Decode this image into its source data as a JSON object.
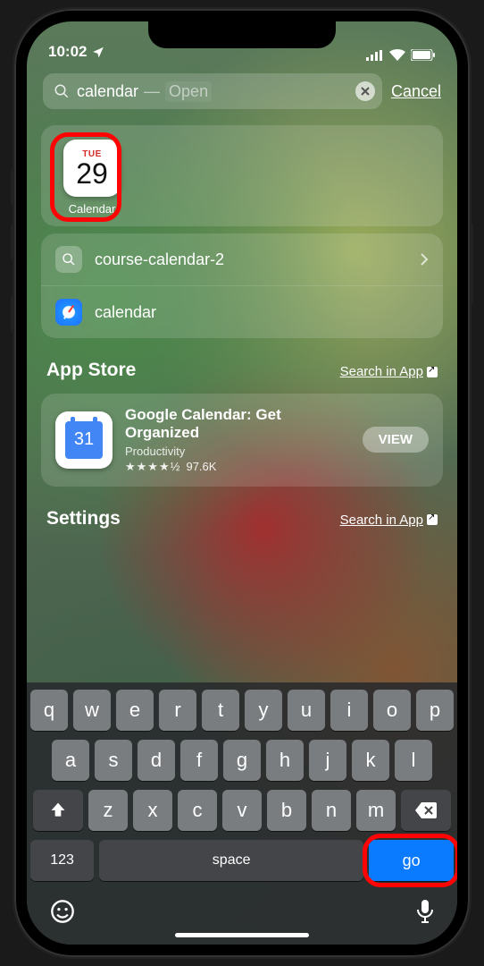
{
  "status": {
    "time": "10:02"
  },
  "search": {
    "query": "calendar",
    "hint": "Open",
    "cancel": "Cancel"
  },
  "top_app": {
    "day_of_week": "TUE",
    "day_number": "29",
    "label": "Calendar"
  },
  "suggestions": [
    {
      "icon": "search",
      "text": "course-calendar-2",
      "chevron": true
    },
    {
      "icon": "safari",
      "text": "calendar",
      "chevron": false
    }
  ],
  "sections": {
    "appstore": {
      "title": "App Store",
      "link": "Search in App",
      "result": {
        "name": "Google Calendar: Get Organized",
        "category": "Productivity",
        "stars": "★★★★½",
        "rating_count": "97.6K",
        "action": "VIEW",
        "icon_number": "31"
      }
    },
    "settings": {
      "title": "Settings",
      "link": "Search in App"
    }
  },
  "keyboard": {
    "rows": [
      [
        "q",
        "w",
        "e",
        "r",
        "t",
        "y",
        "u",
        "i",
        "o",
        "p"
      ],
      [
        "a",
        "s",
        "d",
        "f",
        "g",
        "h",
        "j",
        "k",
        "l"
      ],
      [
        "z",
        "x",
        "c",
        "v",
        "b",
        "n",
        "m"
      ]
    ],
    "num_key": "123",
    "space_key": "space",
    "go_key": "go"
  }
}
